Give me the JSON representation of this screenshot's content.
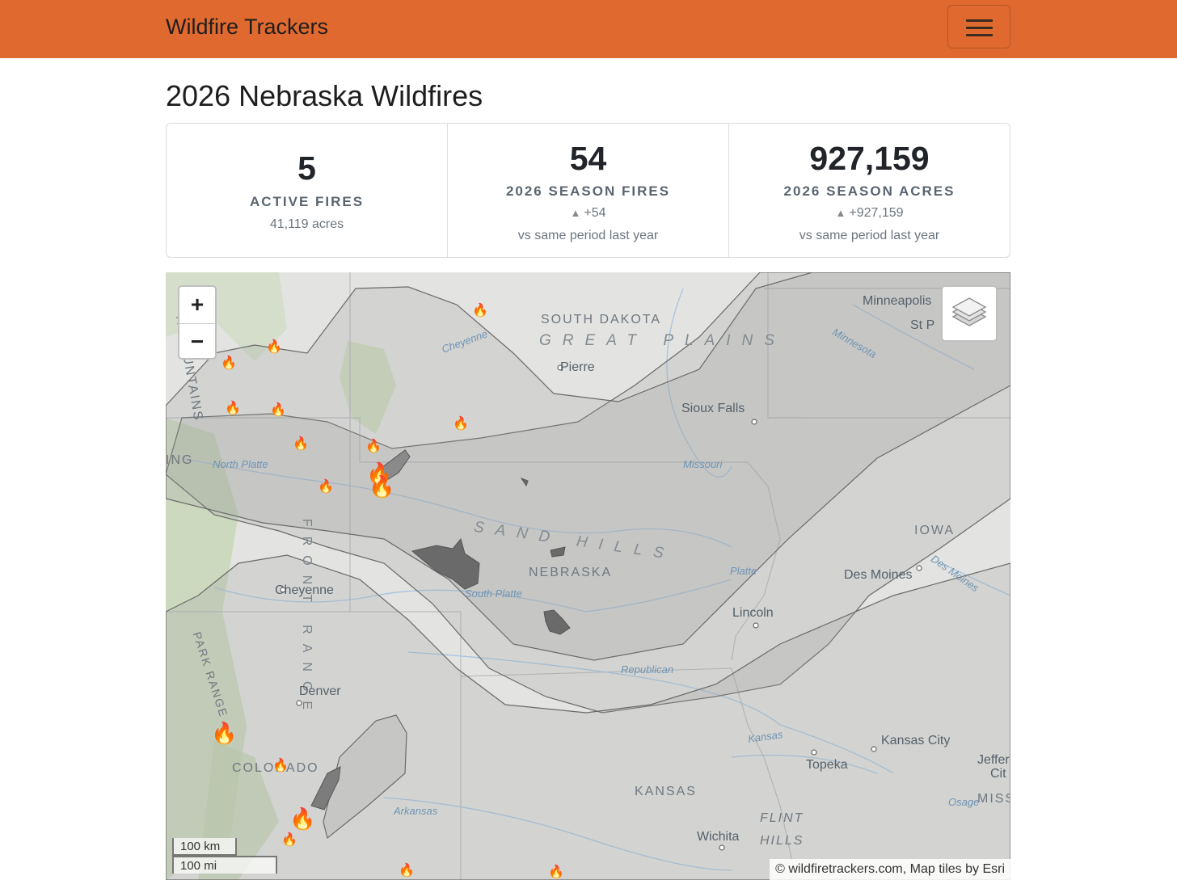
{
  "navbar": {
    "brand": "Wildfire Trackers",
    "menu_icon": "hamburger-icon"
  },
  "page": {
    "title": "2026 Nebraska Wildfires"
  },
  "stats": [
    {
      "value": "5",
      "label": "ACTIVE FIRES",
      "sub": "41,119 acres"
    },
    {
      "value": "54",
      "label": "2026 SEASON FIRES",
      "change": "+54",
      "note": "vs same period last year"
    },
    {
      "value": "927,159",
      "label": "2026 SEASON ACRES",
      "change": "+927,159",
      "note": "vs same period last year"
    }
  ],
  "map": {
    "zoom_in": "+",
    "zoom_out": "−",
    "layers_icon": "layers-icon",
    "scale_km": "100 km",
    "scale_mi": "100 mi",
    "attribution": "© wildfiretrackers.com, Map tiles by Esri",
    "labels": {
      "south_dakota": "SOUTH DAKOTA",
      "great_plains": "GREAT PLAINS",
      "pierre": "Pierre",
      "minneapolis": "Minneapolis",
      "st_paul": "St P",
      "minnesota_river": "Minnesota",
      "sioux_falls": "Sioux Falls",
      "missouri": "Missouri",
      "cheyenne_river": "Cheyenne",
      "mountains": "N MOUNTAINS",
      "wyoming": "ING",
      "north_platte": "North Platte",
      "sand_hills": "SAND HILLS",
      "nebraska": "NEBRASKA",
      "south_platte": "South Platte",
      "platte": "Platte",
      "iowa": "IOWA",
      "des_moines": "Des Moines",
      "des_moines_river": "Des Moines",
      "lincoln": "Lincoln",
      "cheyenne": "Cheyenne",
      "front_range": "FRONT RANGE",
      "park_range": "PARK RANGE",
      "republican": "Republican",
      "denver": "Denver",
      "colorado": "COLORADO",
      "kansas_river": "Kansas",
      "kansas_city": "Kansas City",
      "topeka": "Topeka",
      "jefferson": "Jeffer",
      "jefferson2": "Cit",
      "kansas": "KANSAS",
      "arkansas": "Arkansas",
      "osage": "Osage",
      "missouri_state": "MISSO",
      "flint_hills": "FLINT",
      "flint_hills2": "HILLS",
      "wichita": "Wichita"
    }
  }
}
